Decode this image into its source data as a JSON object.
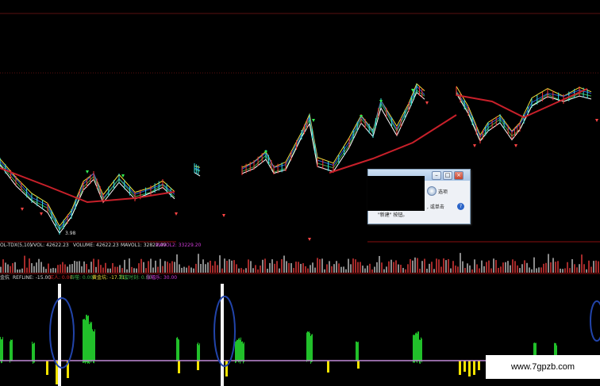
{
  "title_bar_text": "",
  "colors": {
    "background": "#000000",
    "ma_red": "#c8202a",
    "ma_green": "#3fae49",
    "ma_blue": "#2c5dd8",
    "ma_yellow": "#f3e13a",
    "volume_bar": "#8a8a8a",
    "signal_green": "#21c02a",
    "signal_yellow": "#f3e300",
    "refline": "#c28ad8",
    "highlight_circle": "#2244aa",
    "magenta_text": "#d23cdb"
  },
  "price_panel": {
    "low_label": "3.98"
  },
  "volume_panel": {
    "indicator_name": "OL-TDX(5,10)",
    "vvol": "VVOL: 42622.23",
    "volume": "VOLUME: 42622.23",
    "mavol1": "MAVOL1: 32822.00",
    "mavol2": "MAVOL2: 33229.20"
  },
  "indicator_panel": {
    "name": "金抗",
    "refline": "REFLINE: -15.00",
    "items": [
      {
        "label": "买人: 0.00",
        "color": "#e02424"
      },
      {
        "label": "吞噬: 0.00",
        "color": "#3fae49"
      },
      {
        "label": "黄金坑: -17.71",
        "color": "#f3e13a"
      },
      {
        "label": "甜蜜时刻: 0.00",
        "color": "#3fae49"
      },
      {
        "label": "涨幅乐: 30.00",
        "color": "#d23cdb"
      }
    ]
  },
  "dialog": {
    "tab_label": "选项",
    "line1": ", 或单击",
    "line2": "\"新建\" 按钮。",
    "minimize_glyph": "–",
    "restore_glyph": "□",
    "close_glyph": "×",
    "help_glyph": "?"
  },
  "watermark": "www.7gpzb.com"
}
